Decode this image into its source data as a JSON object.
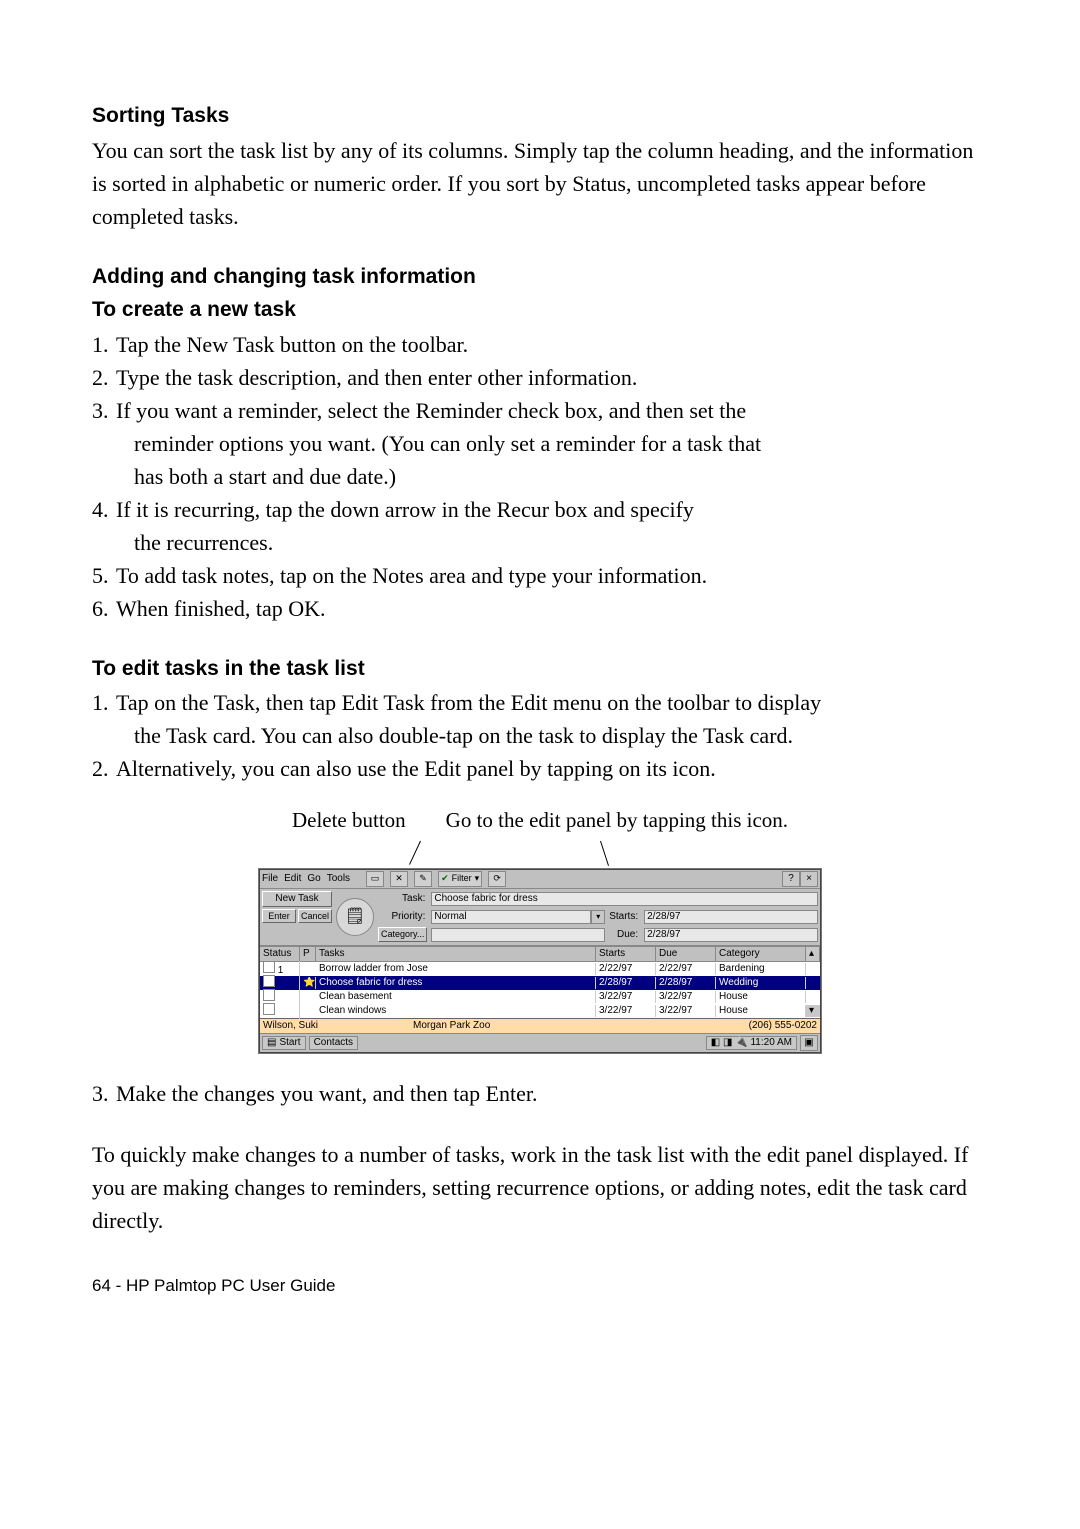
{
  "headings": {
    "sorting": "Sorting Tasks",
    "adding": "Adding and changing task information",
    "create": "To create a new task",
    "edit": "To edit tasks in the task list"
  },
  "paragraphs": {
    "sorting_body": "You can sort the task list by any of its columns. Simply tap the column heading, and the information is sorted in alphabetic or numeric order. If you sort by Status, uncompleted tasks appear before completed tasks.",
    "quick_changes": "To quickly make changes to a number of tasks, work in the task list with the edit panel displayed. If you are making changes to reminders, setting recurrence options, or adding notes, edit the task card directly."
  },
  "create_steps": {
    "s1": "Tap the New Task button on the toolbar.",
    "s2": "Type the task description, and then enter other information.",
    "s3a": "If you want a reminder, select the Reminder check box, and then set the",
    "s3b": "reminder options you want. (You can only set a reminder for a task that",
    "s3c": "has both a start and due date.)",
    "s4a": "If it is recurring, tap the down arrow in the Recur box and specify",
    "s4b": "the recurrences.",
    "s5": "To add task notes, tap on the Notes area and type your information.",
    "s6": "When finished, tap OK."
  },
  "edit_steps": {
    "s1a": "Tap on the Task, then tap Edit Task from the Edit menu on the toolbar to display",
    "s1b": "the Task card. You can also double-tap on the task to display the Task card.",
    "s2": "Alternatively, you can also use the Edit panel by tapping on its icon.",
    "s3": "Make the changes you want, and then tap Enter."
  },
  "annotations": {
    "delete": "Delete button",
    "editpanel": "Go to the edit panel by tapping this icon."
  },
  "screenshot": {
    "menus": {
      "file": "File",
      "edit": "Edit",
      "go": "Go",
      "tools": "Tools"
    },
    "filter_label": "Filter",
    "winbtn_help": "?",
    "winbtn_close": "×",
    "leftpane": {
      "newtask": "New Task",
      "enter": "Enter",
      "cancel": "Cancel"
    },
    "fields": {
      "task_label": "Task:",
      "task_value": "Choose fabric for dress",
      "priority_label": "Priority:",
      "priority_value": "Normal",
      "starts_label": "Starts:",
      "starts_value": "2/28/97",
      "category_label": "Category...",
      "due_label": "Due:",
      "due_value": "2/28/97"
    },
    "columns": {
      "status": "Status",
      "p": "P",
      "tasks": "Tasks",
      "starts": "Starts",
      "due": "Due",
      "category": "Category"
    },
    "rows": [
      {
        "task": "Borrow ladder from Jose",
        "starts": "2/22/97",
        "due": "2/22/97",
        "category": "Bardening"
      },
      {
        "task": "Choose fabric for dress",
        "starts": "2/28/97",
        "due": "2/28/97",
        "category": "Wedding"
      },
      {
        "task": "Clean basement",
        "starts": "3/22/97",
        "due": "3/22/97",
        "category": "House"
      },
      {
        "task": "Clean windows",
        "starts": "3/22/97",
        "due": "3/22/97",
        "category": "House"
      }
    ],
    "status_row": "1",
    "statusbar_left": "Wilson, Suki",
    "statusbar_mid": "Morgan Park Zoo",
    "statusbar_right": "(206) 555-0202",
    "taskbar": {
      "start": "Start",
      "app": "Contacts",
      "clock": "11:20 AM"
    }
  },
  "footer": "64 - HP Palmtop PC User Guide"
}
